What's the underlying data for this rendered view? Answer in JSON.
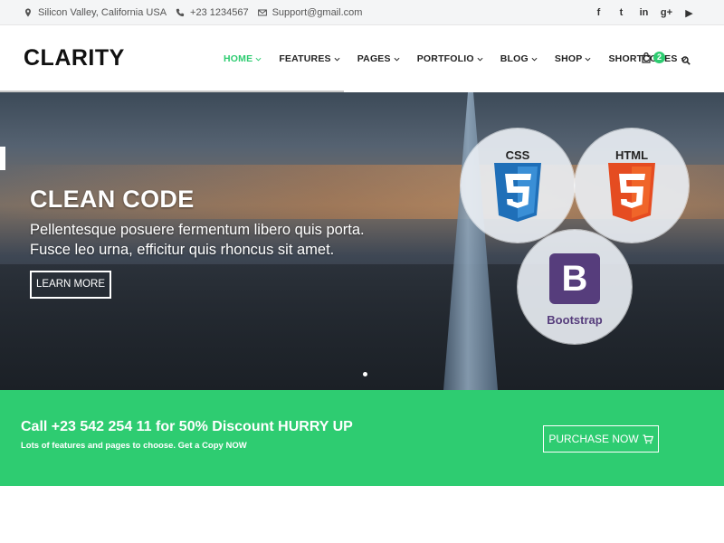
{
  "topbar": {
    "location": "Silicon Valley, California USA",
    "phone": "+23 1234567",
    "email": "Support@gmail.com",
    "social": [
      "f",
      "t",
      "in",
      "g+",
      "▶"
    ]
  },
  "header": {
    "logo": "CLARITY",
    "nav": [
      {
        "label": "HOME",
        "active": true
      },
      {
        "label": "FEATURES",
        "active": false
      },
      {
        "label": "PAGES",
        "active": false
      },
      {
        "label": "PORTFOLIO",
        "active": false
      },
      {
        "label": "BLOG",
        "active": false
      },
      {
        "label": "SHOP",
        "active": false
      },
      {
        "label": "SHORTCODES",
        "active": false
      }
    ],
    "cart_count": "2"
  },
  "hero": {
    "title": "CLEAN CODE",
    "line1": "Pellentesque posuere fermentum libero quis porta.",
    "line2": "Fusce leo urna, efficitur quis rhoncus sit amet.",
    "button": "LEARN MORE",
    "badges": {
      "css": "CSS",
      "css_num": "3",
      "html": "HTML",
      "html_num": "5",
      "bs_letter": "B",
      "bs_label": "Bootstrap"
    }
  },
  "cta": {
    "title": "Call +23 542 254 11 for 50% Discount HURRY UP",
    "subtitle": "Lots of features and pages to choose. Get a Copy NOW",
    "button": "PURCHASE NOW"
  },
  "colors": {
    "accent": "#2ecc71",
    "css_blue": "#1f6fb8",
    "html_orange": "#e54c21",
    "bootstrap_purple": "#563d7c"
  }
}
